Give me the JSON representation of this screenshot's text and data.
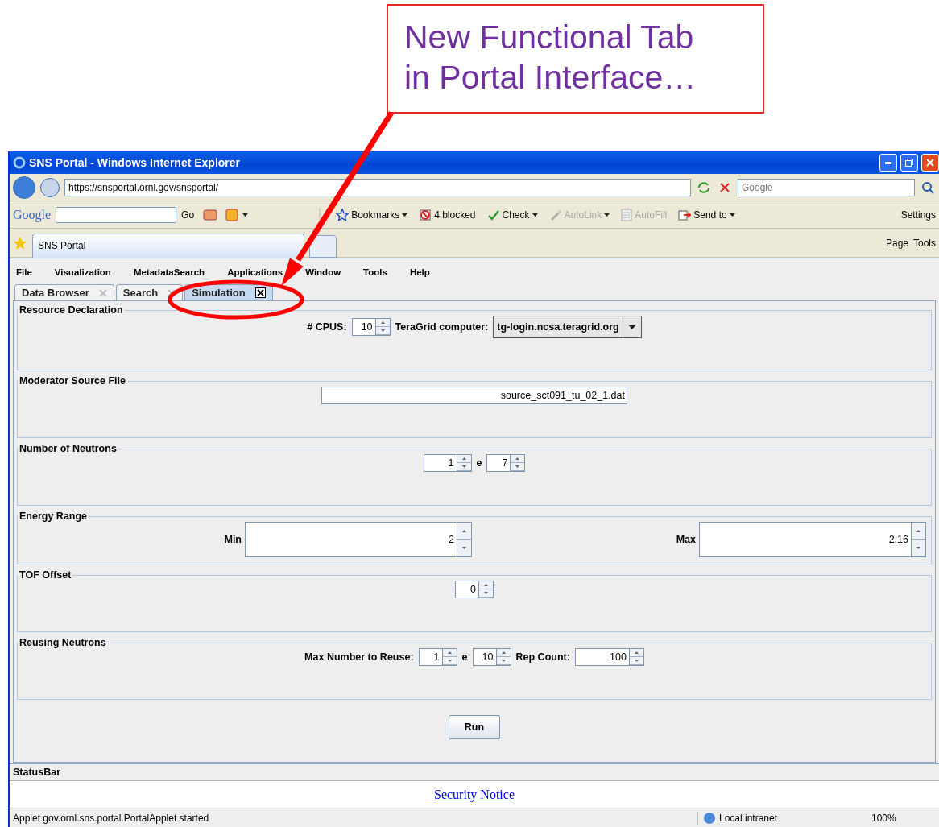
{
  "callout": {
    "lines": [
      "New Functional Tab",
      "in Portal Interface…"
    ]
  },
  "browser": {
    "title": "SNS Portal - Windows Internet Explorer",
    "address": "https://snsportal.ornl.gov/snsportal/",
    "search_placeholder": "Google",
    "google_bar": {
      "logo": "Google",
      "go": "Go",
      "settings": "Settings",
      "items": [
        {
          "kind": "bookmarks",
          "label": "Bookmarks",
          "disabled": false
        },
        {
          "kind": "blocked",
          "label": "4 blocked",
          "disabled": false
        },
        {
          "kind": "check",
          "label": "Check",
          "disabled": false
        },
        {
          "kind": "autolink",
          "label": "AutoLink",
          "disabled": true
        },
        {
          "kind": "autofill",
          "label": "AutoFill",
          "disabled": true
        },
        {
          "kind": "sendto",
          "label": "Send to",
          "disabled": false
        }
      ]
    },
    "tab": "SNS Portal",
    "commands": [
      "Page",
      "Tools"
    ]
  },
  "app": {
    "menu": [
      "File",
      "Visualization",
      "MetadataSearch",
      "Applications",
      "Window",
      "Tools",
      "Help"
    ],
    "tabs": [
      {
        "label": "Data Browser",
        "selected": false
      },
      {
        "label": "Search",
        "selected": false
      },
      {
        "label": "Simulation",
        "selected": true
      }
    ],
    "sections": [
      {
        "kind": "resource",
        "title": "Resource Declaration",
        "cpus_label": "# CPUS:",
        "cpus": "10",
        "computer_label": "TeraGrid computer:",
        "computer": "tg-login.ncsa.teragrid.org"
      },
      {
        "kind": "file",
        "title": "Moderator Source File",
        "value": "source_sct091_tu_02_1.dat"
      },
      {
        "kind": "exponent",
        "title": "Number of Neutrons",
        "mantissa": "1",
        "e": "e",
        "exponent": "7"
      },
      {
        "kind": "range",
        "title": "Energy Range",
        "min_label": "Min",
        "min": "2",
        "max_label": "Max",
        "max": "2.16"
      },
      {
        "kind": "single",
        "title": "TOF Offset",
        "value": "0"
      },
      {
        "kind": "reuse",
        "title": "Reusing Neutrons",
        "max_label": "Max Number to Reuse:",
        "mantissa": "1",
        "e": "e",
        "exponent": "10",
        "rep_label": "Rep Count:",
        "rep": "100"
      }
    ],
    "run_button": "Run",
    "status_bar": "StatusBar"
  },
  "security_notice": "Security Notice",
  "ie_status": {
    "message": "Applet gov.ornl.sns.portal.PortalApplet started",
    "zone": "Local intranet",
    "zoom": "100%"
  }
}
